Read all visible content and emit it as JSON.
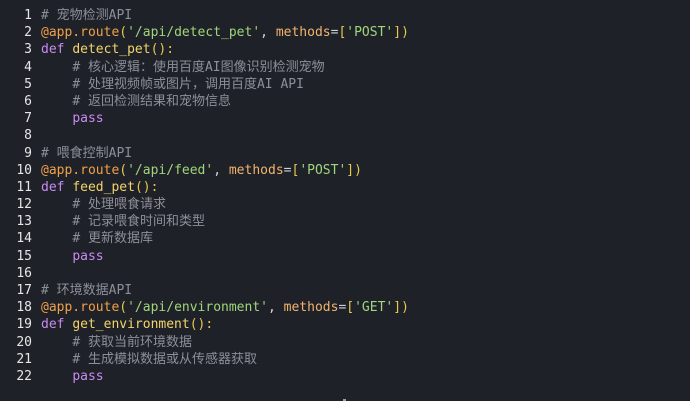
{
  "editor": {
    "lines": [
      {
        "num": "1",
        "tokens": [
          {
            "t": "# 宠物检测API",
            "c": "cmt"
          }
        ]
      },
      {
        "num": "2",
        "tokens": [
          {
            "t": "@app.route",
            "c": "deco"
          },
          {
            "t": "(",
            "c": "brk"
          },
          {
            "t": "'/api/detect_pet'",
            "c": "str"
          },
          {
            "t": ", ",
            "c": "pun"
          },
          {
            "t": "methods",
            "c": "param"
          },
          {
            "t": "=",
            "c": "pun"
          },
          {
            "t": "[",
            "c": "brk"
          },
          {
            "t": "'POST'",
            "c": "str"
          },
          {
            "t": "]",
            "c": "brk"
          },
          {
            "t": ")",
            "c": "brk"
          }
        ]
      },
      {
        "num": "3",
        "tokens": [
          {
            "t": "def ",
            "c": "kw"
          },
          {
            "t": "detect_pet",
            "c": "fn"
          },
          {
            "t": "():",
            "c": "brk"
          }
        ]
      },
      {
        "num": "4",
        "tokens": [
          {
            "t": "    ",
            "c": "pun"
          },
          {
            "t": "# 核心逻辑：使用百度AI图像识别检测宠物",
            "c": "cmt"
          }
        ]
      },
      {
        "num": "5",
        "tokens": [
          {
            "t": "    ",
            "c": "pun"
          },
          {
            "t": "# 处理视频帧或图片，调用百度AI API",
            "c": "cmt"
          }
        ]
      },
      {
        "num": "6",
        "tokens": [
          {
            "t": "    ",
            "c": "pun"
          },
          {
            "t": "# 返回检测结果和宠物信息",
            "c": "cmt"
          }
        ]
      },
      {
        "num": "7",
        "tokens": [
          {
            "t": "    ",
            "c": "pun"
          },
          {
            "t": "pass",
            "c": "kw"
          }
        ]
      },
      {
        "num": "8",
        "tokens": []
      },
      {
        "num": "9",
        "tokens": [
          {
            "t": "# 喂食控制API",
            "c": "cmt"
          }
        ]
      },
      {
        "num": "10",
        "tokens": [
          {
            "t": "@app.route",
            "c": "deco"
          },
          {
            "t": "(",
            "c": "brk"
          },
          {
            "t": "'/api/feed'",
            "c": "str"
          },
          {
            "t": ", ",
            "c": "pun"
          },
          {
            "t": "methods",
            "c": "param"
          },
          {
            "t": "=",
            "c": "pun"
          },
          {
            "t": "[",
            "c": "brk"
          },
          {
            "t": "'POST'",
            "c": "str"
          },
          {
            "t": "]",
            "c": "brk"
          },
          {
            "t": ")",
            "c": "brk"
          }
        ]
      },
      {
        "num": "11",
        "tokens": [
          {
            "t": "def ",
            "c": "kw"
          },
          {
            "t": "feed_pet",
            "c": "fn"
          },
          {
            "t": "():",
            "c": "brk"
          }
        ]
      },
      {
        "num": "12",
        "tokens": [
          {
            "t": "    ",
            "c": "pun"
          },
          {
            "t": "# 处理喂食请求",
            "c": "cmt"
          }
        ]
      },
      {
        "num": "13",
        "tokens": [
          {
            "t": "    ",
            "c": "pun"
          },
          {
            "t": "# 记录喂食时间和类型",
            "c": "cmt"
          }
        ]
      },
      {
        "num": "14",
        "tokens": [
          {
            "t": "    ",
            "c": "pun"
          },
          {
            "t": "# 更新数据库",
            "c": "cmt"
          }
        ]
      },
      {
        "num": "15",
        "tokens": [
          {
            "t": "    ",
            "c": "pun"
          },
          {
            "t": "pass",
            "c": "kw"
          }
        ]
      },
      {
        "num": "16",
        "tokens": []
      },
      {
        "num": "17",
        "tokens": [
          {
            "t": "# 环境数据API",
            "c": "cmt"
          }
        ]
      },
      {
        "num": "18",
        "tokens": [
          {
            "t": "@app.route",
            "c": "deco"
          },
          {
            "t": "(",
            "c": "brk"
          },
          {
            "t": "'/api/environment'",
            "c": "str"
          },
          {
            "t": ", ",
            "c": "pun"
          },
          {
            "t": "methods",
            "c": "param"
          },
          {
            "t": "=",
            "c": "pun"
          },
          {
            "t": "[",
            "c": "brk"
          },
          {
            "t": "'GET'",
            "c": "str"
          },
          {
            "t": "]",
            "c": "brk"
          },
          {
            "t": ")",
            "c": "brk"
          }
        ]
      },
      {
        "num": "19",
        "tokens": [
          {
            "t": "def ",
            "c": "kw"
          },
          {
            "t": "get_environment",
            "c": "fn"
          },
          {
            "t": "():",
            "c": "brk"
          }
        ]
      },
      {
        "num": "20",
        "tokens": [
          {
            "t": "    ",
            "c": "pun"
          },
          {
            "t": "# 获取当前环境数据",
            "c": "cmt"
          }
        ]
      },
      {
        "num": "21",
        "tokens": [
          {
            "t": "    ",
            "c": "pun"
          },
          {
            "t": "# 生成模拟数据或从传感器获取",
            "c": "cmt"
          }
        ]
      },
      {
        "num": "22",
        "tokens": [
          {
            "t": "    ",
            "c": "pun"
          },
          {
            "t": "pass",
            "c": "kw"
          }
        ]
      }
    ]
  }
}
